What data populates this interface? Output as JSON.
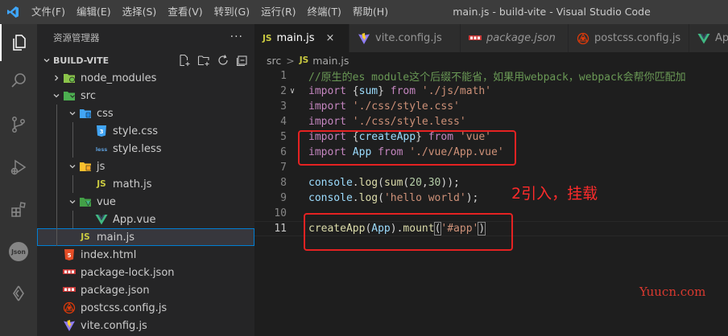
{
  "titlebar": {
    "menu": [
      "文件(F)",
      "编辑(E)",
      "选择(S)",
      "查看(V)",
      "转到(G)",
      "运行(R)",
      "终端(T)",
      "帮助(H)"
    ],
    "window_title": "main.js - build-vite - Visual Studio Code"
  },
  "activity_bar": {
    "json_badge": "Json"
  },
  "sidebar": {
    "header": "资源管理器",
    "more": "···",
    "section": "BUILD-VITE",
    "tree": [
      {
        "label": "node_modules",
        "kind": "folder",
        "depth": 0,
        "expanded": false
      },
      {
        "label": "src",
        "kind": "folder",
        "depth": 0,
        "expanded": true
      },
      {
        "label": "css",
        "kind": "folder",
        "depth": 1,
        "expanded": true
      },
      {
        "label": "style.css",
        "kind": "css",
        "depth": 2
      },
      {
        "label": "style.less",
        "kind": "less",
        "depth": 2
      },
      {
        "label": "js",
        "kind": "folder",
        "depth": 1,
        "expanded": true
      },
      {
        "label": "math.js",
        "kind": "js",
        "depth": 2
      },
      {
        "label": "vue",
        "kind": "folder",
        "depth": 1,
        "expanded": true
      },
      {
        "label": "App.vue",
        "kind": "vue",
        "depth": 2
      },
      {
        "label": "main.js",
        "kind": "js",
        "depth": 1,
        "selected": true
      },
      {
        "label": "index.html",
        "kind": "html",
        "depth": 0
      },
      {
        "label": "package-lock.json",
        "kind": "npm",
        "depth": 0
      },
      {
        "label": "package.json",
        "kind": "npm",
        "depth": 0
      },
      {
        "label": "postcss.config.js",
        "kind": "postcss",
        "depth": 0
      },
      {
        "label": "vite.config.js",
        "kind": "vite",
        "depth": 0
      }
    ],
    "icon_text": {
      "js": "JS",
      "less": "{less}"
    }
  },
  "tabs": [
    {
      "label": "main.js",
      "icon": "js",
      "active": true,
      "italic": false,
      "close": "×"
    },
    {
      "label": "vite.config.js",
      "icon": "vite",
      "active": false,
      "italic": false
    },
    {
      "label": "package.json",
      "icon": "npm",
      "active": false,
      "italic": true
    },
    {
      "label": "postcss.config.js",
      "icon": "postcss",
      "active": false,
      "italic": false
    },
    {
      "label": "App",
      "icon": "vue",
      "active": false,
      "italic": false
    }
  ],
  "breadcrumb": {
    "folder": "src",
    "sep": ">",
    "file_tag": "JS",
    "file": "main.js"
  },
  "code": {
    "current_line": 11,
    "lines": [
      {
        "n": "1",
        "tokens": [
          [
            "c-com",
            "//原生的es module这个后缀不能省，如果用webpack，webpack会帮你匹配加"
          ]
        ]
      },
      {
        "n": "2",
        "fold": "∨",
        "tokens": [
          [
            "c-kw",
            "import"
          ],
          [
            "c-pun",
            " {"
          ],
          [
            "c-var",
            "sum"
          ],
          [
            "c-pun",
            "} "
          ],
          [
            "c-kw",
            "from"
          ],
          [
            "c-pun",
            " "
          ],
          [
            "c-str",
            "'./js/math'"
          ]
        ]
      },
      {
        "n": "3",
        "tokens": [
          [
            "c-kw",
            "import"
          ],
          [
            "c-pun",
            " "
          ],
          [
            "c-str",
            "'./css/style.css'"
          ]
        ]
      },
      {
        "n": "4",
        "tokens": [
          [
            "c-kw",
            "import"
          ],
          [
            "c-pun",
            " "
          ],
          [
            "c-str",
            "'./css/style.less'"
          ]
        ]
      },
      {
        "n": "5",
        "tokens": [
          [
            "c-kw",
            "import"
          ],
          [
            "c-pun",
            " {"
          ],
          [
            "c-var",
            "createApp"
          ],
          [
            "c-pun",
            "} "
          ],
          [
            "c-kw",
            "from"
          ],
          [
            "c-pun",
            " "
          ],
          [
            "c-str",
            "'vue'"
          ]
        ]
      },
      {
        "n": "6",
        "tokens": [
          [
            "c-kw",
            "import"
          ],
          [
            "c-pun",
            " "
          ],
          [
            "c-var",
            "App"
          ],
          [
            "c-pun",
            " "
          ],
          [
            "c-kw",
            "from"
          ],
          [
            "c-pun",
            " "
          ],
          [
            "c-str",
            "'./vue/App.vue'"
          ]
        ]
      },
      {
        "n": "7",
        "tokens": []
      },
      {
        "n": "8",
        "tokens": [
          [
            "c-var",
            "console"
          ],
          [
            "c-pun",
            "."
          ],
          [
            "c-fn",
            "log"
          ],
          [
            "c-pun",
            "("
          ],
          [
            "c-fn",
            "sum"
          ],
          [
            "c-pun",
            "("
          ],
          [
            "c-num",
            "20"
          ],
          [
            "c-pun",
            ","
          ],
          [
            "c-num",
            "30"
          ],
          [
            "c-pun",
            "));"
          ]
        ]
      },
      {
        "n": "9",
        "tokens": [
          [
            "c-var",
            "console"
          ],
          [
            "c-pun",
            "."
          ],
          [
            "c-fn",
            "log"
          ],
          [
            "c-pun",
            "("
          ],
          [
            "c-str",
            "'hello world'"
          ],
          [
            "c-pun",
            ");"
          ]
        ]
      },
      {
        "n": "10",
        "tokens": []
      },
      {
        "n": "11",
        "tokens": [
          [
            "c-fn",
            "createApp"
          ],
          [
            "c-pun",
            "("
          ],
          [
            "c-var",
            "App"
          ],
          [
            "c-pun",
            ")."
          ],
          [
            "c-fn",
            "mount"
          ],
          [
            "c-pun bracket-hl",
            "("
          ],
          [
            "c-str",
            "'#app'"
          ],
          [
            "c-pun bracket-hl",
            ")"
          ]
        ]
      }
    ]
  },
  "annotation": {
    "text": "2引入，挂载",
    "color": "#e52222"
  },
  "watermark": "Yuucn.com"
}
